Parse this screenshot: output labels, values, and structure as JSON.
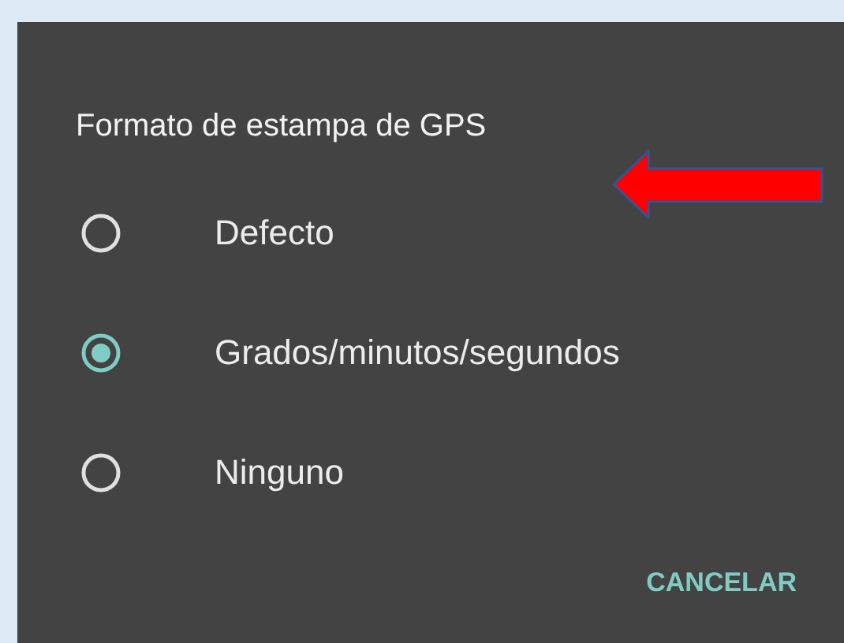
{
  "dialog": {
    "title": "Formato de estampa de GPS",
    "options": [
      {
        "label": "Defecto",
        "selected": false
      },
      {
        "label": "Grados/minutos/segundos",
        "selected": true
      },
      {
        "label": "Ninguno",
        "selected": false
      }
    ],
    "buttons": [
      "CANCELAR"
    ]
  }
}
